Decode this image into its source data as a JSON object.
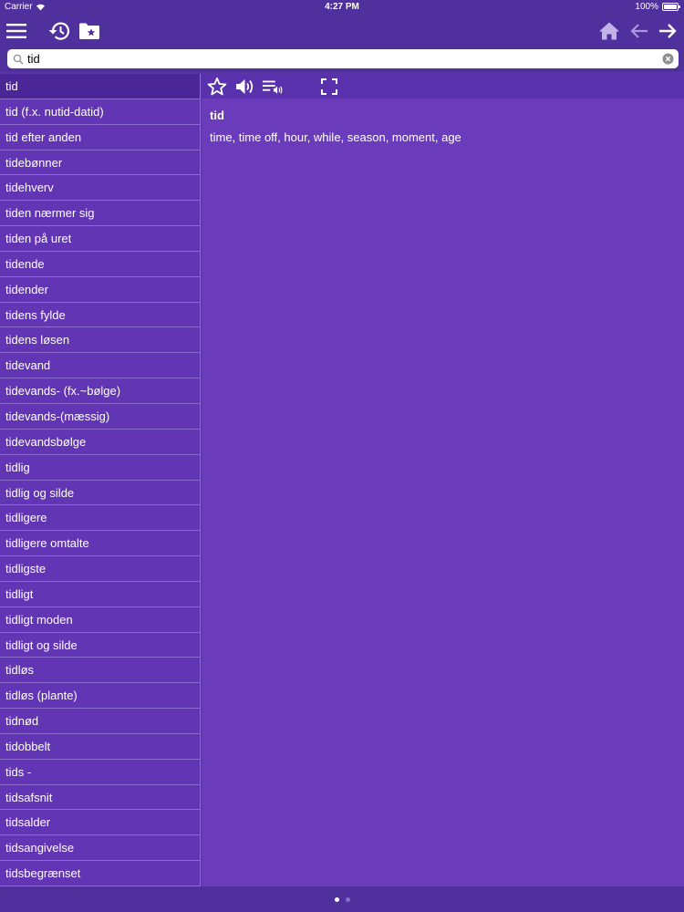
{
  "status": {
    "carrier": "Carrier",
    "time": "4:27 PM",
    "battery": "100%",
    "battery_level": 1.0
  },
  "navbar": {
    "icons": [
      "menu-icon",
      "history-icon",
      "favorites-folder-icon",
      "home-icon",
      "back-arrow-icon",
      "forward-arrow-icon"
    ]
  },
  "search": {
    "value": "tid",
    "placeholder": ""
  },
  "sidebar": {
    "items": [
      "tid",
      "tid (f.x. nutid-datid)",
      "tid efter anden",
      "tidebønner",
      "tidehverv",
      "tiden nærmer sig",
      "tiden på uret",
      "tidende",
      "tidender",
      "tidens fylde",
      "tidens løsen",
      "tidevand",
      "tidevands- (fx.~bølge)",
      "tidevands-(mæssig)",
      "tidevandsbølge",
      "tidlig",
      "tidlig og silde",
      "tidligere",
      "tidligere omtalte",
      "tidligste",
      "tidligt",
      "tidligt moden",
      "tidligt og silde",
      "tidløs",
      "tidløs (plante)",
      "tidnød",
      "tidobbelt",
      "tids -",
      "tidsafsnit",
      "tidsalder",
      "tidsangivelse",
      "tidsbegrænset"
    ],
    "selected_index": 0
  },
  "entry": {
    "word": "tid",
    "definition": "time, time off, hour, while, season, moment, age"
  },
  "toolbar": {
    "icons": [
      "star-icon",
      "speaker-icon",
      "playlist-audio-icon",
      "fullscreen-icon"
    ]
  },
  "pager": {
    "pages": 2,
    "current": 0
  },
  "colors": {
    "bar": "#50309c",
    "sidebar": "#6135b4",
    "selected": "#4a2696",
    "content": "#6a3cbc"
  }
}
